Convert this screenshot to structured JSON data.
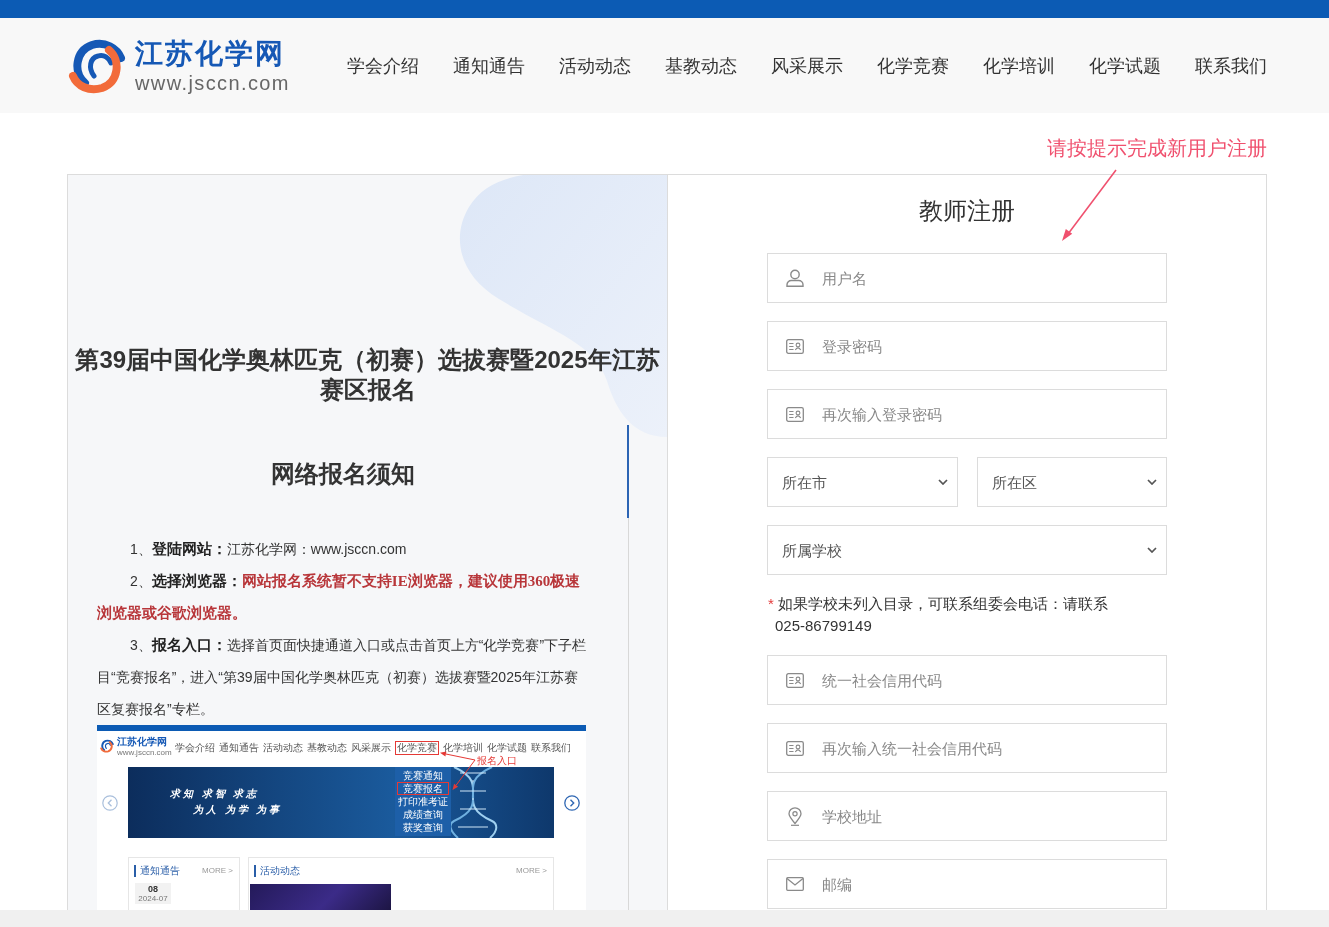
{
  "header": {
    "logo": {
      "title": "江苏化学网",
      "url": "www.jsccn.com"
    },
    "nav": [
      "学会介绍",
      "通知通告",
      "活动动态",
      "基教动态",
      "风采展示",
      "化学竞赛",
      "化学培训",
      "化学试题",
      "联系我们"
    ]
  },
  "annotation": {
    "text": "请按提示完成新用户注册"
  },
  "article": {
    "title": "第39届中国化学奥林匹克（初赛）选拔赛暨2025年江苏赛区报名",
    "subtitle": "网络报名须知",
    "items": [
      {
        "number": "1、",
        "label": "登陆网站：",
        "text": "江苏化学网：www.jsccn.com",
        "emphasis": false
      },
      {
        "number": "2、",
        "label": "选择浏览器：",
        "text": "网站报名系统暂不支持IE浏览器，建议使用360极速浏览器或谷歌浏览器。",
        "emphasis": true
      },
      {
        "number": "3、",
        "label": "报名入口：",
        "text": "选择首页面快捷通道入口或点击首页上方“化学竞赛”下子栏目“竞赛报名”，进入“第39届中国化学奥林匹克（初赛）选拔赛暨2025年江苏赛区复赛报名”专栏。",
        "emphasis": false
      }
    ],
    "figure": {
      "logo_title": "江苏化学网",
      "logo_url": "www.jsccn.com",
      "nav": [
        {
          "label": "学会介绍",
          "highlighted": false
        },
        {
          "label": "通知通告",
          "highlighted": false
        },
        {
          "label": "活动动态",
          "highlighted": false
        },
        {
          "label": "基教动态",
          "highlighted": false
        },
        {
          "label": "风采展示",
          "highlighted": false
        },
        {
          "label": "化学竞赛",
          "highlighted": true
        },
        {
          "label": "化学培训",
          "highlighted": false
        },
        {
          "label": "化学试题",
          "highlighted": false
        },
        {
          "label": "联系我们",
          "highlighted": false
        }
      ],
      "callout": "报名入口",
      "banner_lines": [
        "求知 求智 求志",
        "为人 为学 为事"
      ],
      "menu": [
        {
          "label": "竞赛通知",
          "highlighted": false
        },
        {
          "label": "竞赛报名",
          "highlighted": true
        },
        {
          "label": "打印准考证",
          "highlighted": false
        },
        {
          "label": "成绩查询",
          "highlighted": false
        },
        {
          "label": "获奖查询",
          "highlighted": false
        }
      ],
      "panels": [
        {
          "kind": "dated_list",
          "title": "通知通告",
          "more": "MORE >",
          "date": {
            "day": "08",
            "month": "2024-07"
          }
        },
        {
          "kind": "photo_list",
          "title": "活动动态",
          "more": "MORE >"
        }
      ]
    }
  },
  "registration": {
    "title": "教师注册",
    "fields": [
      {
        "kind": "username",
        "placeholder": "用户名"
      },
      {
        "kind": "password",
        "placeholder": "登录密码"
      },
      {
        "kind": "password",
        "placeholder": "再次输入登录密码"
      },
      {
        "kind": "select_pair",
        "selects": [
          {
            "value": "所在市"
          },
          {
            "value": "所在区"
          }
        ]
      },
      {
        "kind": "select",
        "value": "所属学校"
      },
      {
        "kind": "note",
        "marker": "*",
        "text": "如果学校未列入目录，可联系组委会电话：请联系 025-86799149"
      },
      {
        "kind": "code",
        "placeholder": "统一社会信用代码"
      },
      {
        "kind": "code",
        "placeholder": "再次输入统一社会信用代码"
      },
      {
        "kind": "address",
        "placeholder": "学校地址"
      },
      {
        "kind": "postcode",
        "placeholder": "邮编"
      }
    ]
  }
}
